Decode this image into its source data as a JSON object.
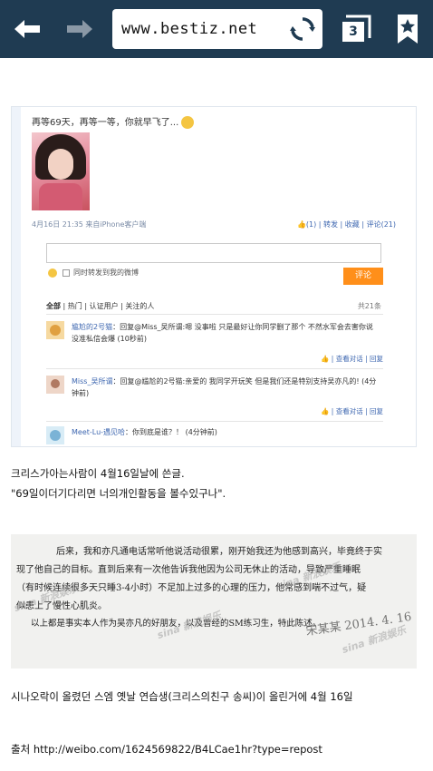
{
  "browser": {
    "url": "www.bestiz.net",
    "tab_count": "3"
  },
  "weibo": {
    "post_text": "再等69天，再等一等，你就早飞了...",
    "meta": "4月16日 21:35  来自iPhone客户端",
    "actions": "👍(1)  |  转发  |  收藏  |  评论(21)",
    "forward_check_label": "同时转发到我的微博",
    "comment_button": "评论",
    "filters": [
      "全部",
      "热门",
      "认证用户",
      "关注的人"
    ],
    "total": "共21条",
    "comments": [
      {
        "name": "尴尬的2号猫",
        "text": "：回复@Miss_吴所谓:嗯 没事啦 只是最好让你同学删了那个 不然水军会去害你说 没准私信会爆 (10秒前)",
        "ops": "👍  |  查看对话  |  回复"
      },
      {
        "name": "Miss_吴所谓",
        "text": "：回复@尴尬的2号猫:亲爱的 我同学开玩笑 但是我们还是特别支持吴亦凡的! (4分钟前)",
        "ops": "👍  |  查看对话  |  回复"
      },
      {
        "name": "Meet-Lu-遇见哈",
        "text": "：你到底是谁？！ (4分钟前)",
        "ops": ""
      }
    ]
  },
  "text1": {
    "line1": "크리스가아는사람이 4월16일날에 쓴글.",
    "line2": "\"69일이더기다리면 너의개인활동을 볼수있구나\"."
  },
  "note": {
    "lines": [
      "后来，我和亦凡通电话常听他说活动很累，刚开始我还为他感到高兴，毕竟终于实",
      "现了他自己的目标。直到后来有一次他告诉我他因为公司无休止的活动，导致严重睡眠",
      "（有时候连续很多天只睡3-4小时）不足加上过多的心理的压力，他常感到喘不过气，疑",
      "似患上了慢性心肌炎。",
      "以上都是事实本人作为吴亦凡的好朋友，以及曾经的SM练习生，特此陈述。"
    ],
    "signature": "宋某某  2014. 4. 16",
    "watermark": "sina 新浪娱乐"
  },
  "text2": "시나오락이 올렸던 스엠 옛날 연습생(크리스의친구 송씨)이 올린거에 4월 16일",
  "source": "출처 http://weibo.com/1624569822/B4LCae1hr?type=repost"
}
